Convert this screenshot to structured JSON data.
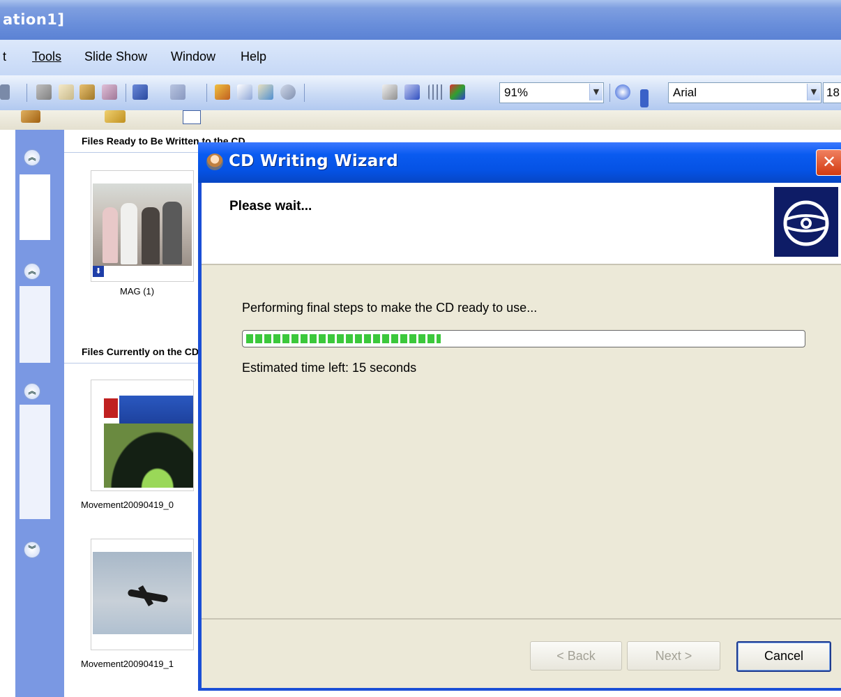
{
  "app": {
    "title": "ation1]"
  },
  "menubar": {
    "items": [
      {
        "label": "t"
      },
      {
        "label": "Tools"
      },
      {
        "label": "Slide Show"
      },
      {
        "label": "Window"
      },
      {
        "label": "Help"
      }
    ]
  },
  "toolbar": {
    "zoom": "91%",
    "font": "Arial",
    "font_size": "18"
  },
  "file_pane": {
    "section_ready": "Files Ready to Be Written to the CD",
    "section_current": "Files Currently on the CD",
    "files_ready": [
      {
        "name": "MAG (1)"
      }
    ],
    "files_current": [
      {
        "name": "Movement20090419_0"
      },
      {
        "name": "Movement20090419_1"
      }
    ]
  },
  "dialog": {
    "title": "CD Writing Wizard",
    "header": "Please wait...",
    "status": "Performing final steps to make the CD ready to use...",
    "progress": 0.35,
    "time_left": "Estimated time left: 15 seconds",
    "buttons": {
      "back": "< Back",
      "next": "Next >",
      "cancel": "Cancel"
    },
    "close_glyph": "✕"
  },
  "colors": {
    "dialog_title": "#0552e4",
    "progress_fill": "#3cc83c",
    "dialog_body": "#ece9d8"
  }
}
